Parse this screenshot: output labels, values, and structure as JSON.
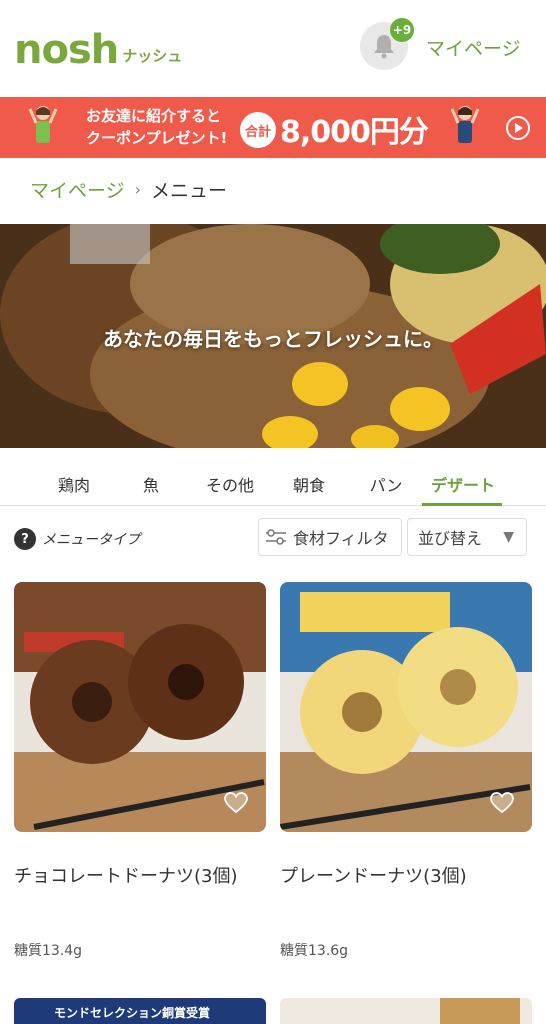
{
  "header": {
    "logo_main": "nosh",
    "logo_sub": "ナッシュ",
    "notification_count": "+9",
    "mypage_label": "マイページ"
  },
  "banner": {
    "line1": "お友達に紹介すると",
    "line2": "クーポンプレゼント!",
    "total_label": "合計",
    "amount": "8,000円分"
  },
  "breadcrumb": {
    "parent": "マイページ",
    "current": "メニュー"
  },
  "hero": {
    "tagline": "あなたの毎日をもっとフレッシュに。"
  },
  "tabs": [
    {
      "label": "鶏肉"
    },
    {
      "label": "魚"
    },
    {
      "label": "その他"
    },
    {
      "label": "朝食"
    },
    {
      "label": "パン"
    },
    {
      "label": "デザート"
    }
  ],
  "filters": {
    "menu_type_label": "メニュータイプ",
    "ingredient_filter_label": "食材フィルタ",
    "sort_label": "並び替え"
  },
  "products": [
    {
      "name": "チョコレートドーナツ(3個)",
      "carb": "糖質13.4g"
    },
    {
      "name": "プレーンドーナツ(3個)",
      "carb": "糖質13.6g"
    }
  ],
  "next_row": {
    "left_label": "モンドセレクション銅賞受賞"
  },
  "colors": {
    "brand_green": "#6aa33a",
    "banner_red": "#f05a4a"
  }
}
